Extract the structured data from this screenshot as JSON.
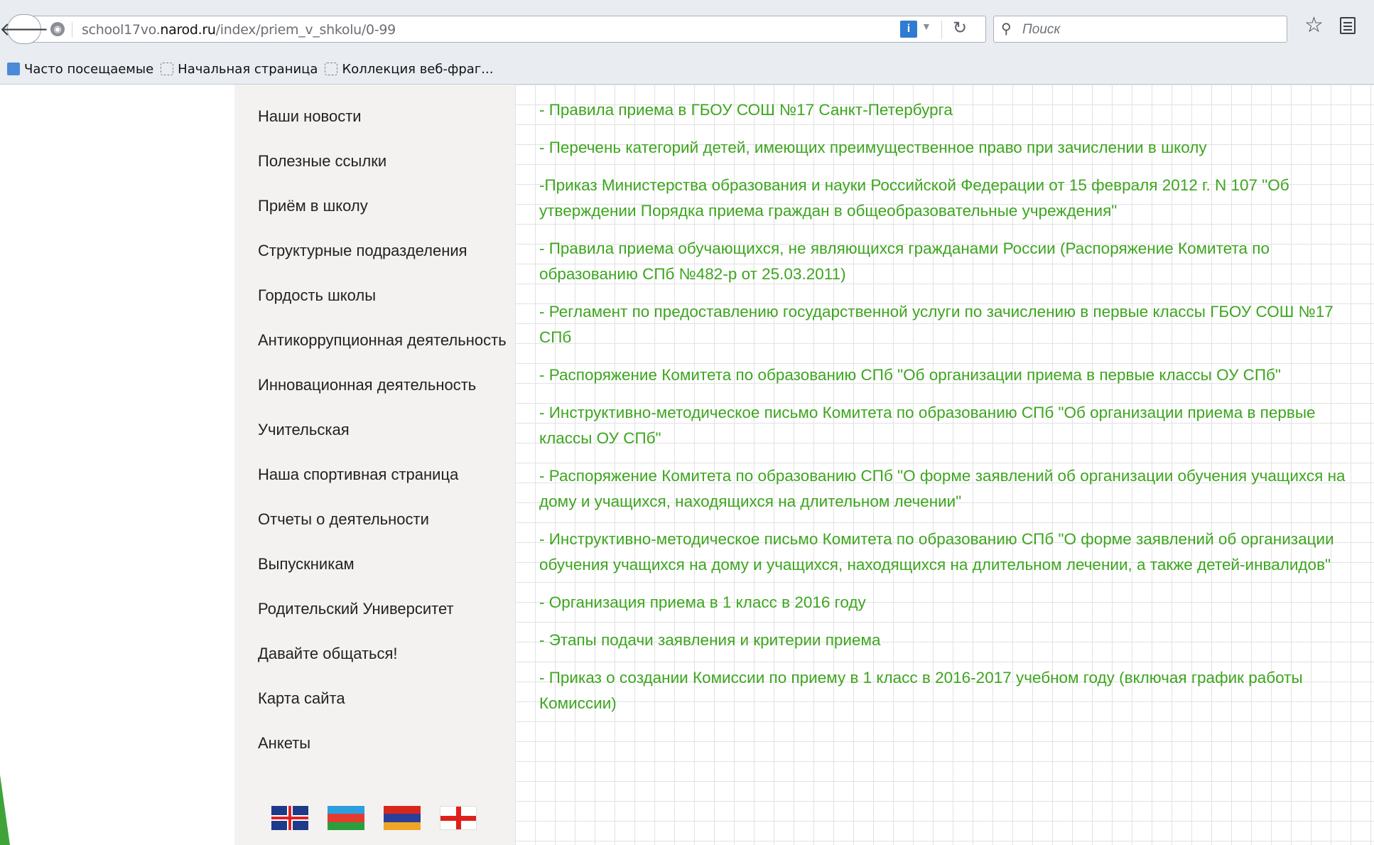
{
  "browser": {
    "url_prefix": "school17vo.",
    "url_domain": "narod.ru",
    "url_path": "/index/priem_v_shkolu/0-99",
    "info_icon": "info-icon",
    "search_placeholder": "Поиск",
    "bookmarks": [
      "Часто посещаемые",
      "Начальная страница",
      "Коллекция веб-фраг..."
    ]
  },
  "sidebar": {
    "items": [
      "Наши новости",
      "Полезные ссылки",
      "Приём в школу",
      "Структурные подразделения",
      "Гордость школы",
      "Антикоррупционная деятельность",
      "Инновационная деятельность",
      "Учительская",
      "Наша спортивная страница",
      "Отчеты о деятельности",
      "Выпускникам",
      "Родительский Университет",
      "Давайте общаться!",
      "Карта сайта",
      "Анкеты"
    ],
    "flags": [
      "uk-flag",
      "azerbaijan-flag",
      "armenia-flag",
      "georgia-flag"
    ]
  },
  "content": {
    "links": [
      "- Правила приема в ГБОУ СОШ №17 Санкт-Петербурга",
      "- Перечень категорий детей, имеющих преимущественное право при зачислении в школу",
      "-Приказ Министерства образования и науки Российской Федерации от 15 февраля 2012 г. N 107 \"Об утверждении Порядка приема граждан в общеобразовательные учреждения\"",
      "- Правила приема обучающихся, не являющихся гражданами России (Распоряжение Комитета по образованию СПб №482-р от 25.03.2011)",
      "- Регламент по предоставлению государственной услуги по зачислению в первые классы ГБОУ СОШ №17 СПб",
      "- Распоряжение Комитета по образованию СПб \"Об организации приема в первые классы ОУ СПб\"",
      "- Инструктивно-методическое письмо Комитета по образованию СПб \"Об организации приема в первые классы ОУ СПб\"",
      "- Распоряжение Комитета по образованию СПб \"О форме заявлений об организации обучения учащихся на дому и учащихся, находящихся на длительном лечении\"",
      "- Инструктивно-методическое письмо Комитета по образованию СПб \"О форме заявлений об организации обучения учащихся на дому и учащихся, находящихся на длительном лечении, а также детей-инвалидов\"",
      "- Организация приема в 1 класс в 2016 году",
      "- Этапы подачи заявления и критерии приема",
      "- Приказ о создании Комиссии по приему в 1 класс в 2016-2017 учебном году (включая график работы Комиссии)"
    ]
  },
  "colors": {
    "link": "#3da51f",
    "sidebar_bg": "#f3f2f0",
    "chrome_bg": "#e9ecf1"
  }
}
